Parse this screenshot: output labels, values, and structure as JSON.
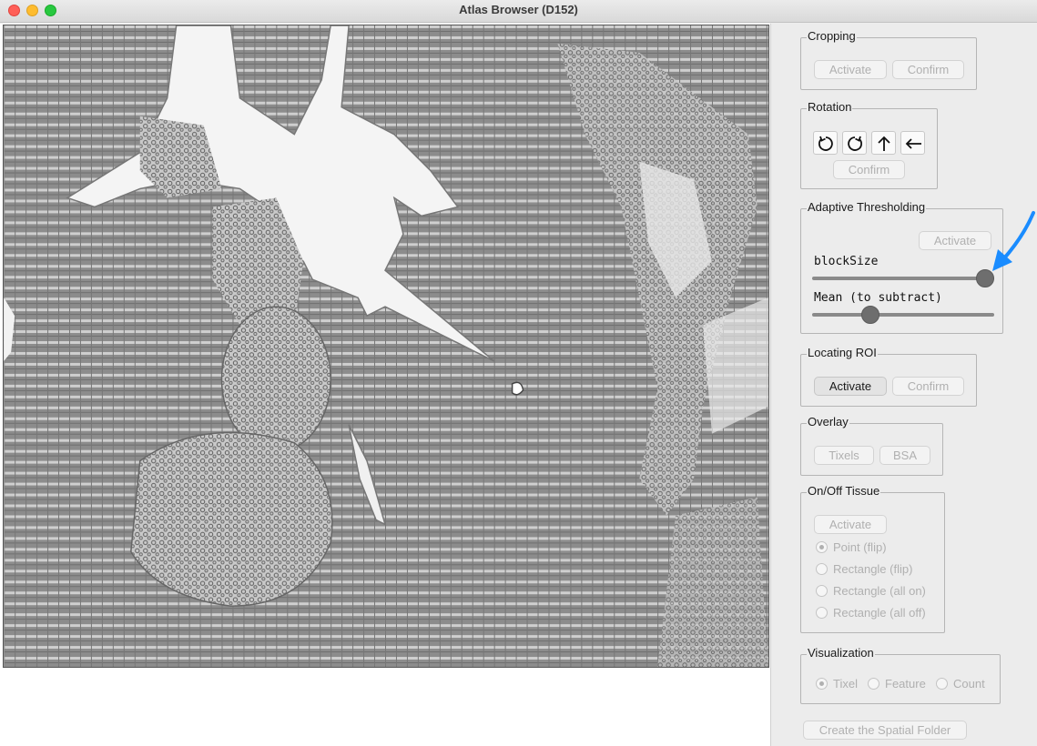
{
  "window": {
    "title": "Atlas Browser (D152)"
  },
  "colors": {
    "close": "#ff5f57",
    "minimize": "#febc2e",
    "zoom": "#28c840",
    "annotation_arrow": "#1a8cff"
  },
  "cropping": {
    "title": "Cropping",
    "activate": "Activate",
    "confirm": "Confirm"
  },
  "rotation": {
    "title": "Rotation",
    "icons": [
      "rotate-ccw-icon",
      "rotate-cw-icon",
      "arrow-up-icon",
      "arrow-left-icon"
    ],
    "confirm": "Confirm"
  },
  "adaptive": {
    "title": "Adaptive Thresholding",
    "activate": "Activate",
    "block_label": "blockSize",
    "block_value": 1.0,
    "mean_label": "Mean (to subtract)",
    "mean_value": 0.3
  },
  "roi": {
    "title": "Locating ROI",
    "activate": "Activate",
    "confirm": "Confirm"
  },
  "overlay": {
    "title": "Overlay",
    "tixels": "Tixels",
    "bsa": "BSA"
  },
  "onoff": {
    "title": "On/Off Tissue",
    "activate": "Activate",
    "options": [
      "Point (flip)",
      "Rectangle (flip)",
      "Rectangle (all on)",
      "Rectangle (all off)"
    ],
    "selected": "Point (flip)"
  },
  "visualization": {
    "title": "Visualization",
    "options": [
      "Tixel",
      "Feature",
      "Count"
    ],
    "selected": "Tixel"
  },
  "create_folder": "Create the Spatial Folder"
}
